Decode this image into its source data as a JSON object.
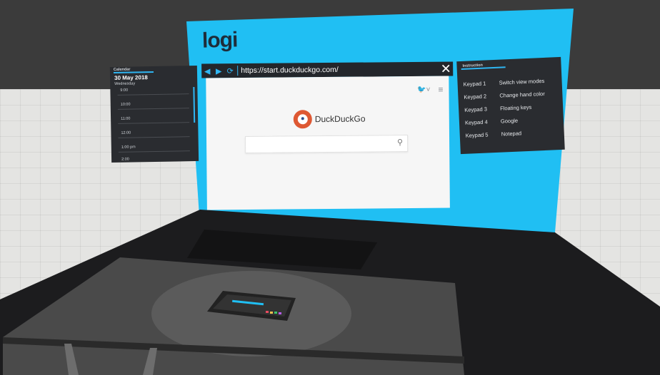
{
  "colors": {
    "accent": "#20bff3",
    "panel": "#2a2c30",
    "floor": "#e4e4e2",
    "ddg_orange": "#de5833"
  },
  "backdrop": {
    "logo_text": "logi"
  },
  "browser": {
    "url": "https://start.duckduckgo.com/",
    "back_icon": "back-arrow-icon",
    "forward_icon": "forward-arrow-icon",
    "refresh_icon": "refresh-icon",
    "close_icon": "close-icon",
    "page": {
      "brand_name": "DuckDuckGo",
      "search_value": "",
      "twitter_icon": "twitter-icon",
      "menu_icon": "hamburger-menu-icon",
      "search_icon": "search-icon"
    }
  },
  "calendar": {
    "tab_label": "Calendar",
    "date": "30 May 2018",
    "weekday": "Wednesday",
    "hours": [
      "9:00",
      "10:00",
      "11:00",
      "12:00",
      "1:00 pm",
      "2:00"
    ]
  },
  "instructions": {
    "tab_label": "Instruction",
    "rows": [
      {
        "key": "Keypad 1",
        "action": "Switch view modes"
      },
      {
        "key": "Keypad 2",
        "action": "Change hand color"
      },
      {
        "key": "Keypad 3",
        "action": "Floating keys"
      },
      {
        "key": "Keypad 4",
        "action": "Google"
      },
      {
        "key": "Keypad 5",
        "action": "Notepad"
      }
    ]
  }
}
